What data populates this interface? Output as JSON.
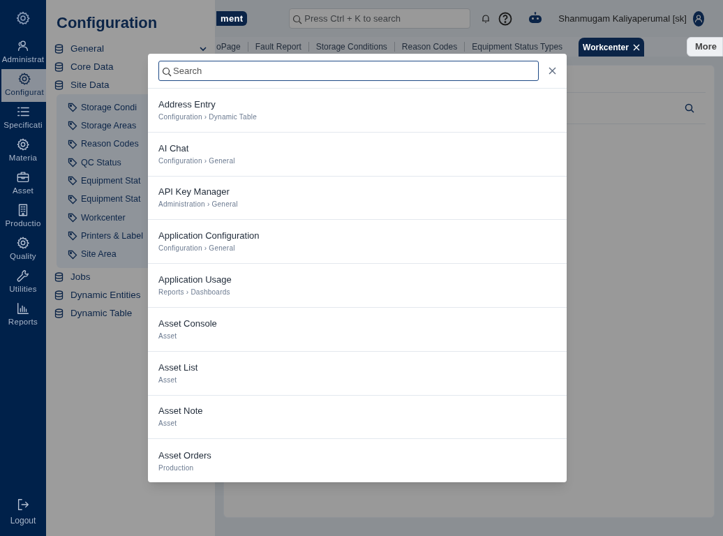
{
  "rail": {
    "items": [
      {
        "label": "Administrat",
        "selected": false
      },
      {
        "label": "Configurat",
        "selected": true
      },
      {
        "label": "Specificati",
        "selected": false
      },
      {
        "label": "Materia",
        "selected": false
      },
      {
        "label": "Asset",
        "selected": false
      },
      {
        "label": "Productio",
        "selected": false
      },
      {
        "label": "Quality",
        "selected": false
      },
      {
        "label": "Utilities",
        "selected": false
      },
      {
        "label": "Reports",
        "selected": false
      }
    ],
    "logout": "Logout"
  },
  "panel": {
    "title": "Configuration",
    "groups": [
      {
        "label": "General",
        "kind": "menu"
      },
      {
        "label": "Core Data",
        "kind": "plain"
      },
      {
        "label": "Site Data",
        "kind": "plain",
        "children": [
          "Storage Condi",
          "Storage Areas",
          "Reason Codes",
          "QC Status",
          "Equipment Stat",
          "Equipment Stat",
          "Workcenter",
          "Printers & Label",
          "Site Area"
        ]
      },
      {
        "label": "Jobs",
        "kind": "plain"
      },
      {
        "label": "Dynamic Entities",
        "kind": "plain"
      },
      {
        "label": "Dynamic Table",
        "kind": "plain"
      }
    ]
  },
  "header": {
    "badge": "ment",
    "search_placeholder": "Press Ctrl + K to search",
    "user": "Shanmugam Kaliyaperumal [sk]"
  },
  "tabs": [
    {
      "label": "oPage",
      "selected": false
    },
    {
      "label": "Fault Report",
      "selected": false
    },
    {
      "label": "Storage Conditions",
      "selected": false
    },
    {
      "label": "Reason Codes",
      "selected": false
    },
    {
      "label": "Equipment Status Types",
      "selected": false
    },
    {
      "label": "Workcenter",
      "selected": true
    }
  ],
  "more": "More",
  "modal": {
    "search_placeholder": "Search",
    "results": [
      {
        "title": "Address Entry",
        "path": "Configuration › Dynamic Table"
      },
      {
        "title": "AI Chat",
        "path": "Configuration › General"
      },
      {
        "title": "API Key Manager",
        "path": "Administration › General"
      },
      {
        "title": "Application Configuration",
        "path": "Configuration › General"
      },
      {
        "title": "Application Usage",
        "path": "Reports › Dashboards"
      },
      {
        "title": "Asset Console",
        "path": "Asset"
      },
      {
        "title": "Asset List",
        "path": "Asset"
      },
      {
        "title": "Asset Note",
        "path": "Asset"
      },
      {
        "title": "Asset Orders",
        "path": "Production"
      }
    ]
  }
}
